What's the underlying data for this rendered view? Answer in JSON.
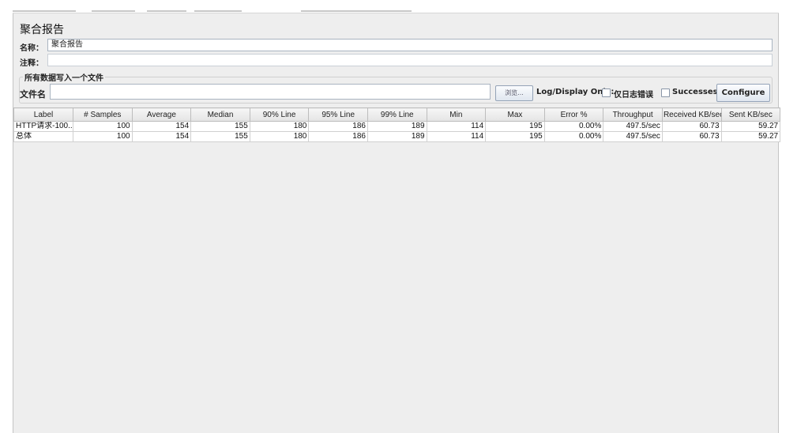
{
  "title": "聚合报告",
  "name_label": "名称：",
  "name_value": "聚合报告",
  "comment_label": "注释：",
  "comment_value": "",
  "file_group_legend": "所有数据写入一个文件",
  "filename_label": "文件名",
  "filename_value": "",
  "browse_label": "浏览...",
  "log_display_label": "Log/Display Only:",
  "errors_only_label": "仅日志错误",
  "errors_only_checked": false,
  "successes_label": "Successes",
  "successes_checked": false,
  "configure_label": "Configure",
  "table": {
    "columns": [
      "Label",
      "# Samples",
      "Average",
      "Median",
      "90% Line",
      "95% Line",
      "99% Line",
      "Min",
      "Max",
      "Error %",
      "Throughput",
      "Received KB/sec",
      "Sent KB/sec"
    ],
    "rows": [
      [
        "HTTP请求-100...",
        "100",
        "154",
        "155",
        "180",
        "186",
        "189",
        "114",
        "195",
        "0.00%",
        "497.5/sec",
        "60.73",
        "59.27"
      ],
      [
        "总体",
        "100",
        "154",
        "155",
        "180",
        "186",
        "189",
        "114",
        "195",
        "0.00%",
        "497.5/sec",
        "60.73",
        "59.27"
      ]
    ]
  }
}
